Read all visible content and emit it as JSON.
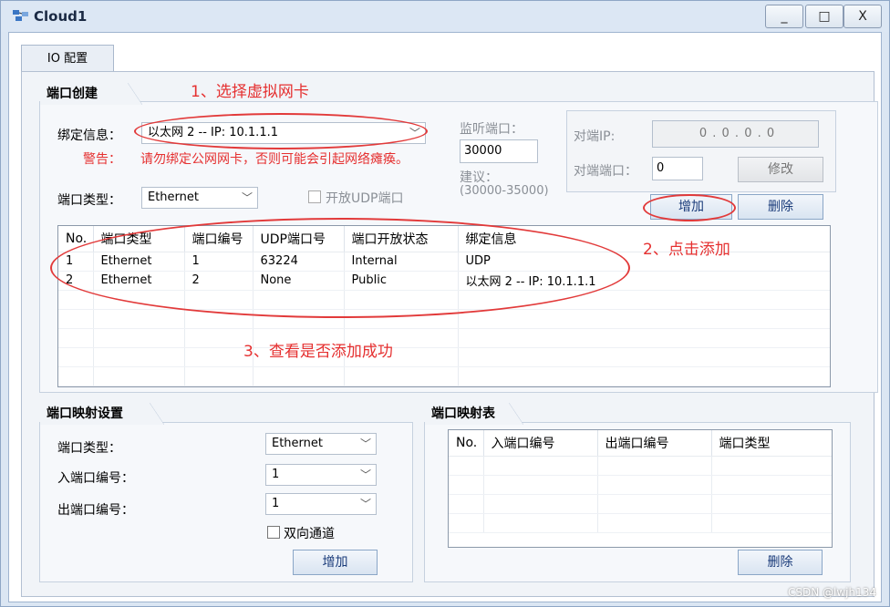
{
  "window": {
    "title": "Cloud1",
    "minimize_icon": "minimize-icon",
    "maximize_icon": "maximize-icon",
    "close_icon": "close-icon",
    "minimize_glyph": "_",
    "maximize_glyph": "□",
    "close_glyph": "X"
  },
  "tabs": [
    {
      "label": "IO 配置"
    }
  ],
  "port_create": {
    "group_title": "端口创建",
    "bind_label": "绑定信息：",
    "bind_value": "以太网 2 -- IP: 10.1.1.1",
    "warn_label": "警告：",
    "warn_text": "请勿绑定公网网卡，否则可能会引起网络瘫痪。",
    "port_type_label": "端口类型：",
    "port_type_value": "Ethernet",
    "udp_open_label": "开放UDP端口",
    "listen_label": "监听端口：",
    "listen_value": "30000",
    "suggest_label": "建议：",
    "suggest_range": "(30000-35000)",
    "peer_ip_label": "对端IP:",
    "peer_ip_value": "0 . 0 . 0 . 0",
    "peer_port_label": "对端端口：",
    "peer_port_value": "0",
    "modify_button": "修改",
    "add_button": "增加",
    "delete_button": "删除"
  },
  "port_table": {
    "columns": [
      "No.",
      "端口类型",
      "端口编号",
      "UDP端口号",
      "端口开放状态",
      "绑定信息"
    ],
    "rows": [
      [
        "1",
        "Ethernet",
        "1",
        "63224",
        "Internal",
        "UDP"
      ],
      [
        "2",
        "Ethernet",
        "2",
        "None",
        "Public",
        "以太网 2 -- IP: 10.1.1.1"
      ]
    ]
  },
  "mapping_settings": {
    "group_title": "端口映射设置",
    "port_type_label": "端口类型：",
    "port_type_value": "Ethernet",
    "in_port_label": "入端口编号：",
    "in_port_value": "1",
    "out_port_label": "出端口编号：",
    "out_port_value": "1",
    "bidirectional_label": "双向通道",
    "add_button": "增加"
  },
  "mapping_table": {
    "group_title": "端口映射表",
    "columns": [
      "No.",
      "入端口编号",
      "出端口编号",
      "端口类型"
    ],
    "delete_button": "删除"
  },
  "annotations": {
    "step1": "1、选择虚拟网卡",
    "step2": "2、点击添加",
    "step3": "3、查看是否添加成功"
  },
  "watermark": "CSDN @lwjh134",
  "colors": {
    "annotation": "#e53030",
    "accent": "#1a3b7a"
  }
}
